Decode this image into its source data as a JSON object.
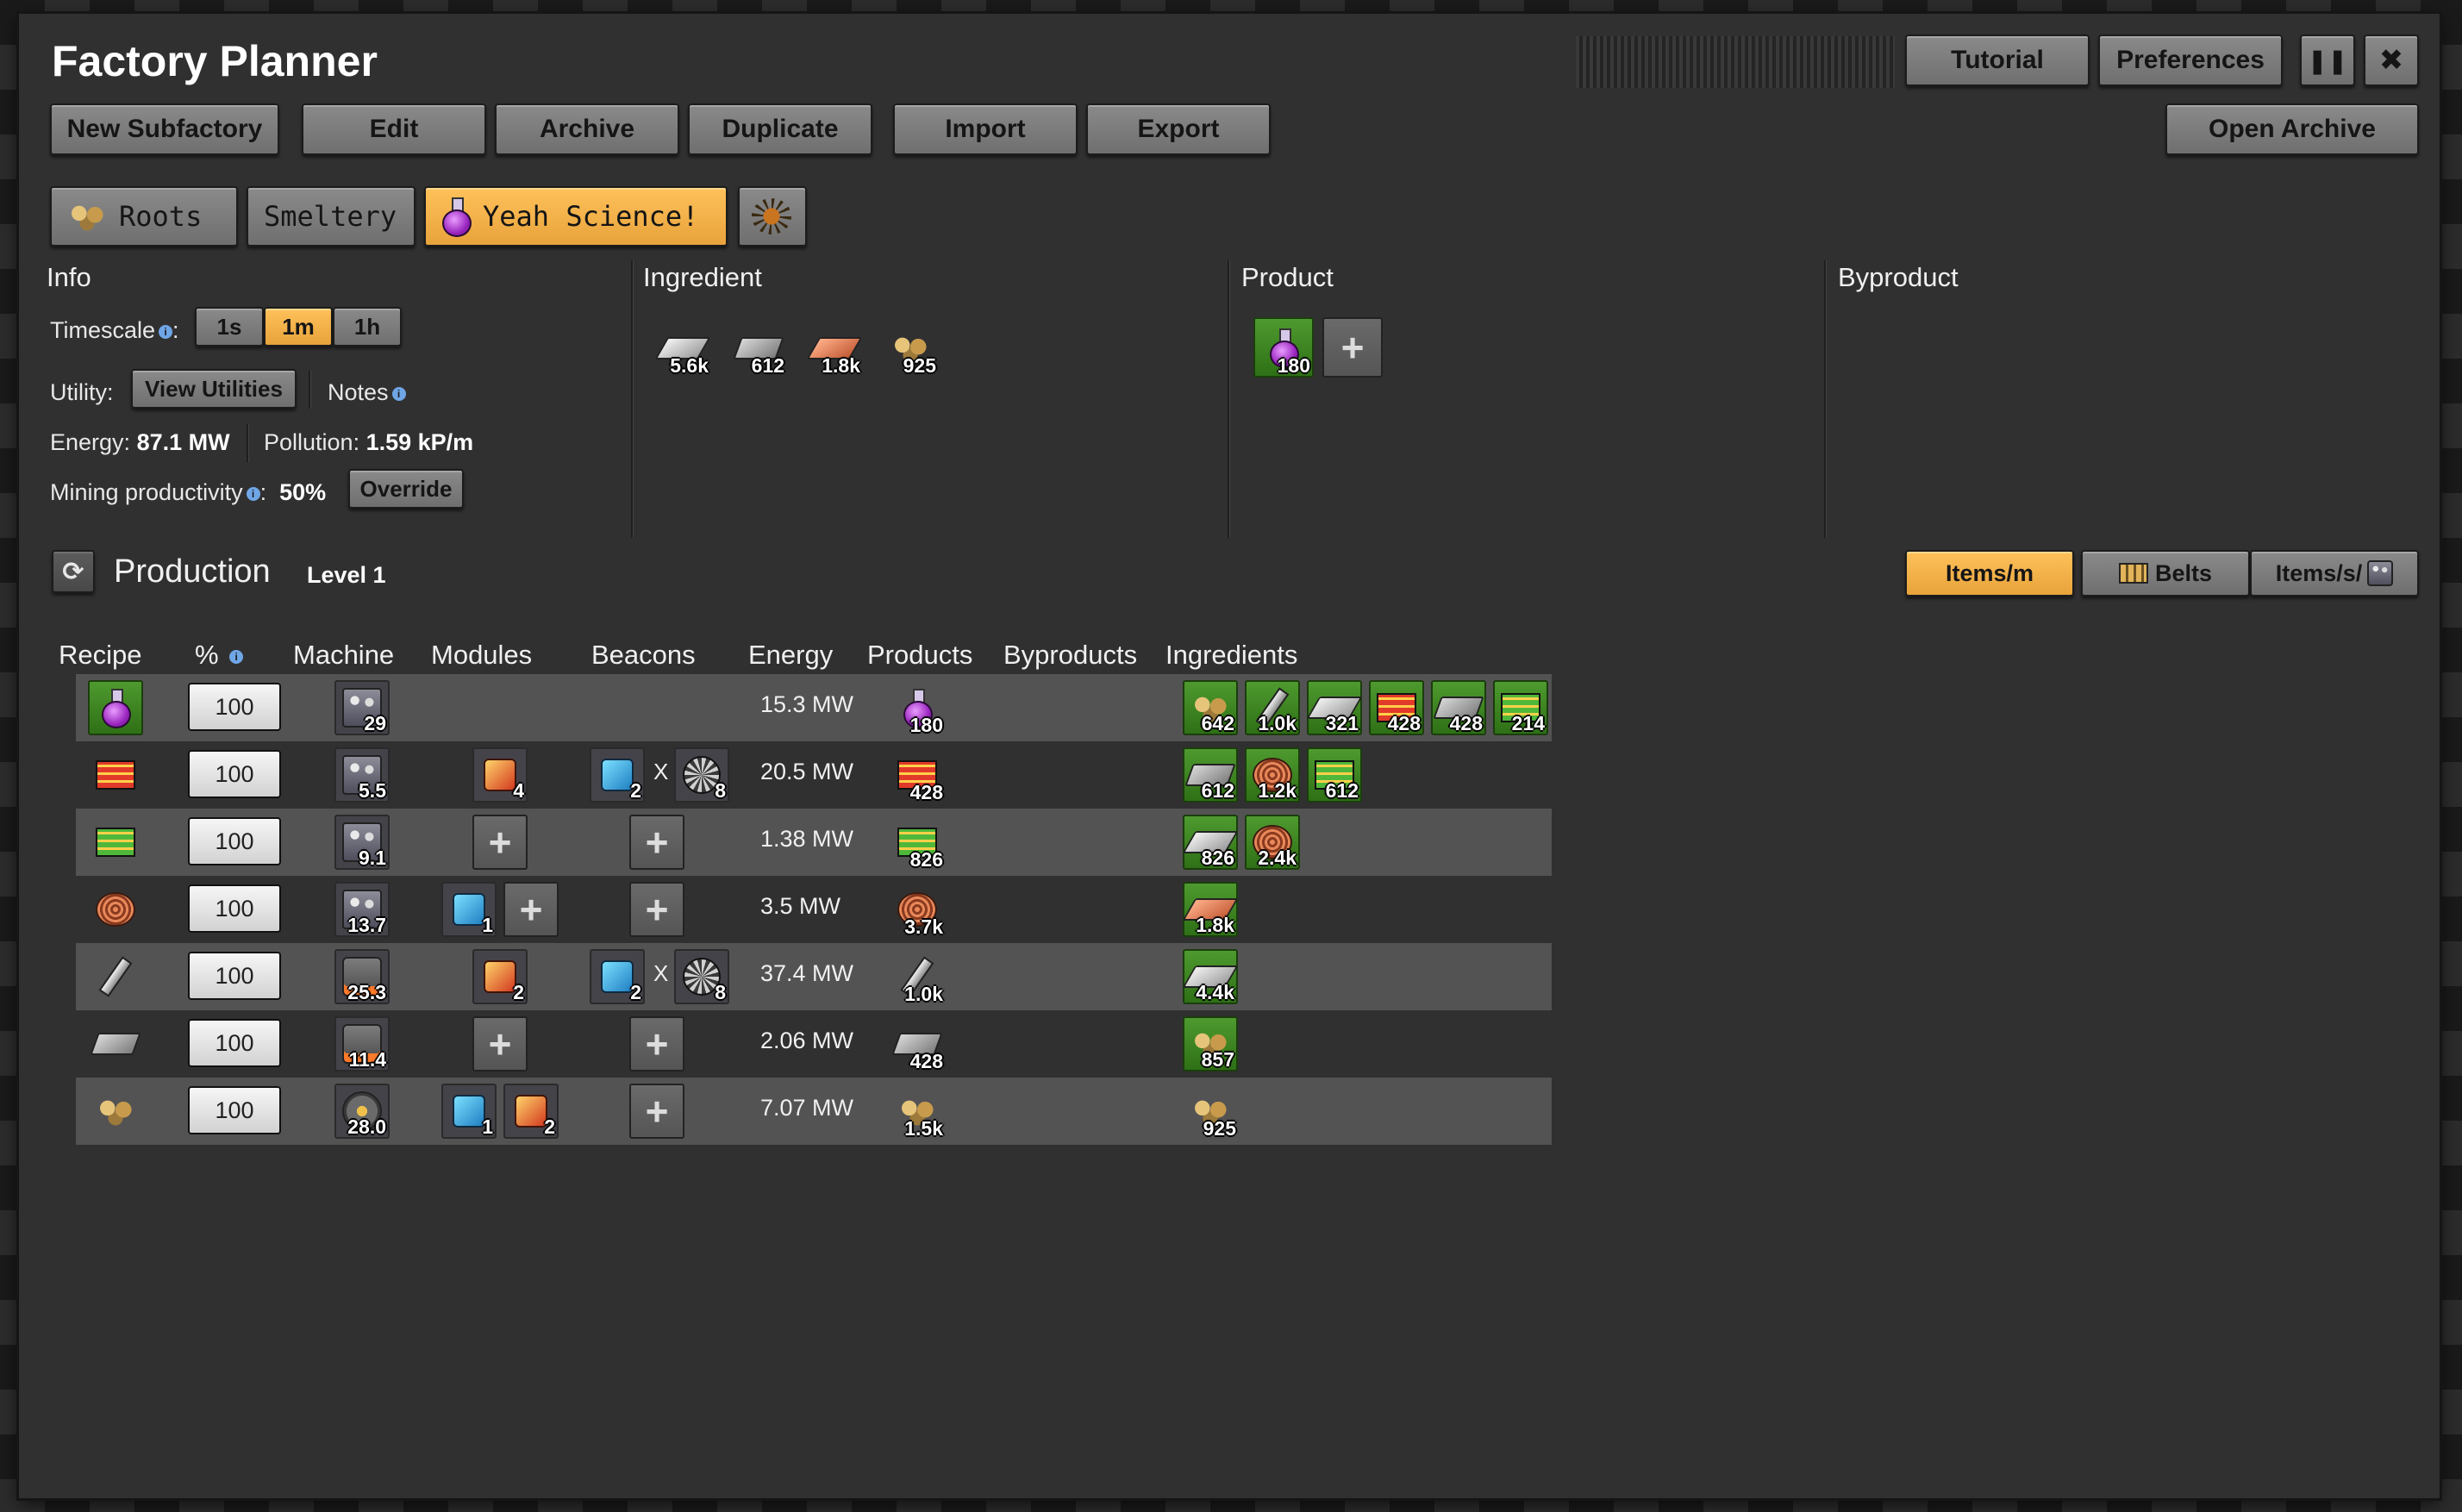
{
  "app": {
    "title": "Factory Planner"
  },
  "titlebar": {
    "tutorial": "Tutorial",
    "preferences": "Preferences",
    "pause_icon": "pause-icon",
    "close_icon": "close-icon"
  },
  "actions": {
    "new_subfactory": "New Subfactory",
    "edit": "Edit",
    "archive": "Archive",
    "duplicate": "Duplicate",
    "import": "Import",
    "export": "Export",
    "open_archive": "Open Archive"
  },
  "subfactories": [
    {
      "label": "Roots",
      "icon": "ore-icon"
    },
    {
      "label": "Smeltery",
      "icon": ""
    },
    {
      "label": "Yeah Science!",
      "icon": "science-flask-icon",
      "selected": true
    },
    {
      "label": "",
      "icon": "spidertron-icon"
    }
  ],
  "info": {
    "title": "Info",
    "timescale_label": "Timescale",
    "timescale_options": [
      "1s",
      "1m",
      "1h"
    ],
    "timescale_selected": "1m",
    "utility_label": "Utility:",
    "view_utilities": "View Utilities",
    "notes_label": "Notes",
    "energy_label": "Energy:",
    "energy_value": "87.1 MW",
    "pollution_label": "Pollution:",
    "pollution_value": "1.59 kP/m",
    "mining_label": "Mining productivity",
    "mining_value": "50%",
    "override": "Override"
  },
  "ingredient": {
    "title": "Ingredient",
    "items": [
      {
        "icon": "iron-plate-icon",
        "amount": "5.6k"
      },
      {
        "icon": "steel-plate-icon",
        "amount": "612"
      },
      {
        "icon": "copper-plate-icon",
        "amount": "1.8k"
      },
      {
        "icon": "ore-icon",
        "amount": "925"
      }
    ]
  },
  "product": {
    "title": "Product",
    "items": [
      {
        "icon": "science-flask-icon",
        "amount": "180"
      }
    ]
  },
  "byproduct": {
    "title": "Byproduct"
  },
  "production": {
    "title": "Production",
    "level": "Level 1",
    "view_options": [
      "Items/m",
      "Belts",
      "Items/s/"
    ],
    "view_selected": "Items/m",
    "columns": [
      "Recipe",
      "%",
      "Machine",
      "Modules",
      "Beacons",
      "Energy",
      "Products",
      "Byproducts",
      "Ingredients"
    ],
    "beacon_times": "X",
    "rows": [
      {
        "recipe": "science-flask-icon",
        "percent": "100",
        "machine": "assembler-icon",
        "machine_count": "29",
        "modules": [],
        "beacon": null,
        "energy": "15.3 MW",
        "product": {
          "icon": "science-flask-icon",
          "amount": "180"
        },
        "ingredients": [
          {
            "icon": "ore-icon",
            "amount": "642"
          },
          {
            "icon": "rod-icon",
            "amount": "1.0k"
          },
          {
            "icon": "iron-plate-icon",
            "amount": "321"
          },
          {
            "icon": "red-circuit-icon",
            "amount": "428"
          },
          {
            "icon": "steel-plate-icon",
            "amount": "428"
          },
          {
            "icon": "green-circuit-icon",
            "amount": "214"
          }
        ]
      },
      {
        "recipe": "red-circuit-icon",
        "percent": "100",
        "machine": "assembler-icon",
        "machine_count": "5.5",
        "modules": [
          {
            "icon": "productivity-module-icon",
            "count": "4"
          }
        ],
        "beacon": {
          "module_count": "2",
          "beacon_count": "8"
        },
        "energy": "20.5 MW",
        "product": {
          "icon": "red-circuit-icon",
          "amount": "428"
        },
        "ingredients": [
          {
            "icon": "steel-plate-icon",
            "amount": "612"
          },
          {
            "icon": "copper-cable-icon",
            "amount": "1.2k"
          },
          {
            "icon": "green-circuit-icon",
            "amount": "612"
          }
        ]
      },
      {
        "recipe": "green-circuit-icon",
        "percent": "100",
        "machine": "assembler-icon",
        "machine_count": "9.1",
        "modules": [],
        "beacon": null,
        "energy": "1.38 MW",
        "product": {
          "icon": "green-circuit-icon",
          "amount": "826"
        },
        "ingredients": [
          {
            "icon": "iron-plate-icon",
            "amount": "826"
          },
          {
            "icon": "copper-cable-icon",
            "amount": "2.4k"
          }
        ]
      },
      {
        "recipe": "copper-cable-icon",
        "percent": "100",
        "machine": "assembler-icon",
        "machine_count": "13.7",
        "modules": [
          {
            "icon": "speed-module-icon",
            "count": "1"
          }
        ],
        "beacon": null,
        "energy": "3.5 MW",
        "product": {
          "icon": "copper-cable-icon",
          "amount": "3.7k"
        },
        "ingredients": [
          {
            "icon": "copper-plate-icon",
            "amount": "1.8k"
          }
        ]
      },
      {
        "recipe": "rod-icon",
        "percent": "100",
        "machine": "furnace-icon",
        "machine_count": "25.3",
        "modules": [
          {
            "icon": "productivity-module-icon",
            "count": "2"
          }
        ],
        "beacon": {
          "module_count": "2",
          "beacon_count": "8"
        },
        "energy": "37.4 MW",
        "product": {
          "icon": "rod-icon",
          "amount": "1.0k"
        },
        "ingredients": [
          {
            "icon": "iron-plate-icon",
            "amount": "4.4k"
          }
        ]
      },
      {
        "recipe": "steel-plate-icon",
        "percent": "100",
        "machine": "furnace-icon",
        "machine_count": "11.4",
        "modules": [],
        "beacon": null,
        "energy": "2.06 MW",
        "product": {
          "icon": "steel-plate-icon",
          "amount": "428"
        },
        "ingredients": [
          {
            "icon": "ore-icon",
            "amount": "857"
          }
        ]
      },
      {
        "recipe": "ore-icon",
        "percent": "100",
        "machine": "drill-icon",
        "machine_count": "28.0",
        "modules": [
          {
            "icon": "speed-module-icon",
            "count": "1"
          },
          {
            "icon": "productivity-module-icon",
            "count": "2"
          }
        ],
        "beacon": null,
        "energy": "7.07 MW",
        "product": {
          "icon": "ore-icon",
          "amount": "1.5k"
        },
        "ingredients": [
          {
            "icon": "ore-icon",
            "amount": "925"
          }
        ]
      }
    ]
  },
  "colors": {
    "accent": "#f2b04a",
    "panel": "#313031",
    "row_alt": "#545354",
    "slot_green": "#3f8a22"
  }
}
